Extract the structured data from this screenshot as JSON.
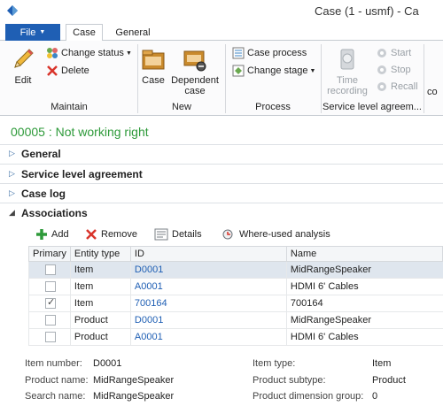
{
  "window": {
    "title": "Case (1 - usmf) - Ca"
  },
  "tabs": {
    "file": "File",
    "case": "Case",
    "general": "General"
  },
  "colors": {
    "accent": "#1f5fb4",
    "status_green": "#2e9a3a",
    "link": "#1f5fb4"
  },
  "ribbon": {
    "maintain": {
      "label": "Maintain",
      "edit": "Edit",
      "change_status": "Change status",
      "delete": "Delete"
    },
    "new": {
      "label": "New",
      "case": "Case",
      "dependent_case_line1": "Dependent",
      "dependent_case_line2": "case"
    },
    "process": {
      "label": "Process",
      "case_process": "Case process",
      "change_stage": "Change stage"
    },
    "sla": {
      "label": "Service level agreem...",
      "time_recording_line1": "Time",
      "time_recording_line2": "recording",
      "start": "Start",
      "stop": "Stop",
      "recall": "Recall"
    },
    "overflow_label": "co"
  },
  "record": {
    "title": "00005 : Not working right"
  },
  "fasttabs": {
    "general": "General",
    "sla": "Service level agreement",
    "case_log": "Case log",
    "associations": "Associations"
  },
  "associations": {
    "toolbar": {
      "add": "Add",
      "remove": "Remove",
      "details": "Details",
      "where_used": "Where-used analysis"
    },
    "columns": {
      "primary": "Primary",
      "entity_type": "Entity type",
      "id": "ID",
      "name": "Name"
    },
    "rows": [
      {
        "primary": false,
        "entity_type": "Item",
        "id": "D0001",
        "name": "MidRangeSpeaker",
        "selected": true
      },
      {
        "primary": false,
        "entity_type": "Item",
        "id": "A0001",
        "name": "HDMI 6' Cables",
        "selected": false
      },
      {
        "primary": true,
        "entity_type": "Item",
        "id": "700164",
        "name": "700164",
        "selected": false
      },
      {
        "primary": false,
        "entity_type": "Product",
        "id": "D0001",
        "name": "MidRangeSpeaker",
        "selected": false
      },
      {
        "primary": false,
        "entity_type": "Product",
        "id": "A0001",
        "name": "HDMI 6' Cables",
        "selected": false
      }
    ]
  },
  "details": {
    "item_number_label": "Item number:",
    "item_number": "D0001",
    "product_name_label": "Product name:",
    "product_name": "MidRangeSpeaker",
    "search_name_label": "Search name:",
    "search_name": "MidRangeSpeaker",
    "item_type_label": "Item type:",
    "item_type": "Item",
    "product_subtype_label": "Product subtype:",
    "product_subtype": "Product",
    "product_dimension_group_label": "Product dimension group:",
    "product_dimension_group": "0"
  }
}
